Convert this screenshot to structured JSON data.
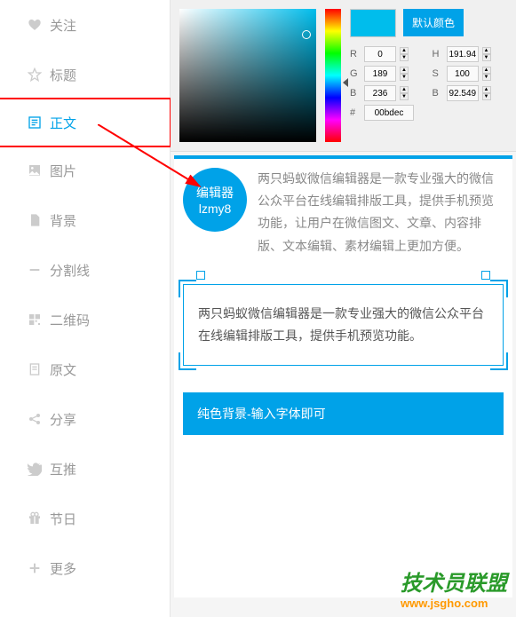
{
  "sidebar": {
    "items": [
      {
        "label": "关注",
        "icon": "heart"
      },
      {
        "label": "标题",
        "icon": "star"
      },
      {
        "label": "正文",
        "icon": "text",
        "active": true
      },
      {
        "label": "图片",
        "icon": "image"
      },
      {
        "label": "背景",
        "icon": "file"
      },
      {
        "label": "分割线",
        "icon": "minus"
      },
      {
        "label": "二维码",
        "icon": "qr"
      },
      {
        "label": "原文",
        "icon": "doc"
      },
      {
        "label": "分享",
        "icon": "share"
      },
      {
        "label": "互推",
        "icon": "twitter"
      },
      {
        "label": "节日",
        "icon": "gift"
      },
      {
        "label": "更多",
        "icon": "plus"
      }
    ]
  },
  "colorPicker": {
    "defaultBtn": "默认颜色",
    "preview": "#00bdec",
    "r": "0",
    "g": "189",
    "b": "236",
    "h": "191.94",
    "s": "100",
    "br": "92.549",
    "hex": "00bdec"
  },
  "content": {
    "circle": {
      "line1": "编辑器",
      "line2": "lzmy8"
    },
    "para1": "两只蚂蚁微信编辑器是一款专业强大的微信公众平台在线编辑排版工具，提供手机预览功能，让用户在微信图文、文章、内容排版、文本编辑、素材编辑上更加方便。",
    "para2": "两只蚂蚁微信编辑器是一款专业强大的微信公众平台在线编辑排版工具，提供手机预览功能。",
    "para3": "纯色背景-输入字体即可"
  },
  "watermark": {
    "logo": "技术员联盟",
    "url": "www.jsgho.com"
  }
}
